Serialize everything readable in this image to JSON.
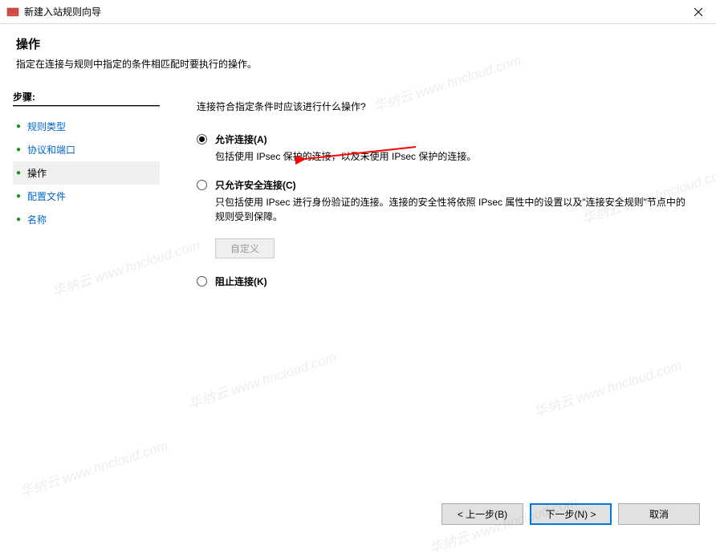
{
  "titlebar": {
    "title": "新建入站规则向导"
  },
  "heading": "操作",
  "subheading": "指定在连接与规则中指定的条件相匹配时要执行的操作。",
  "sidebar": {
    "stepsLabel": "步骤:",
    "items": [
      {
        "label": "规则类型",
        "current": false
      },
      {
        "label": "协议和端口",
        "current": false
      },
      {
        "label": "操作",
        "current": true
      },
      {
        "label": "配置文件",
        "current": false
      },
      {
        "label": "名称",
        "current": false
      }
    ]
  },
  "main": {
    "prompt": "连接符合指定条件时应该进行什么操作?",
    "options": [
      {
        "label": "允许连接(A)",
        "desc": "包括使用 IPsec 保护的连接，以及未使用 IPsec 保护的连接。",
        "checked": true
      },
      {
        "label": "只允许安全连接(C)",
        "desc": "只包括使用 IPsec 进行身份验证的连接。连接的安全性将依照 IPsec 属性中的设置以及\"连接安全规则\"节点中的规则受到保障。",
        "checked": false
      },
      {
        "label": "阻止连接(K)",
        "desc": "",
        "checked": false
      }
    ],
    "customBtn": "自定义"
  },
  "buttons": {
    "back": "< 上一步(B)",
    "next": "下一步(N) >",
    "cancel": "取消"
  },
  "watermark": "华纳云 www.hncloud.com"
}
